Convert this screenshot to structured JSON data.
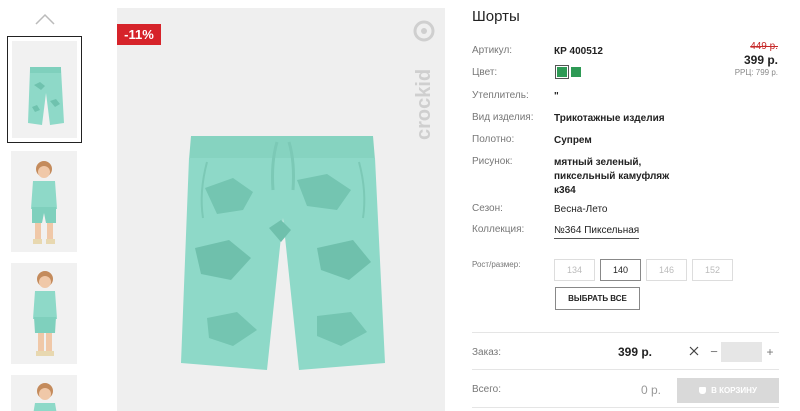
{
  "colors": {
    "accent_red": "#d6232a",
    "mint": "#8ed9c8",
    "swatch_green": "#2e9a55",
    "muted": "#777777"
  },
  "product": {
    "discount_badge": "-11%",
    "brand_logo_text": "crockid",
    "title": "Шорты",
    "old_price": "449 р.",
    "price": "399 р.",
    "rrp": "РРЦ: 799 р."
  },
  "attributes": [
    {
      "label": "Артикул:",
      "value": "КР 400512"
    },
    {
      "label": "Цвет:",
      "value": ""
    },
    {
      "label": "Утеплитель:",
      "value": "\""
    },
    {
      "label": "Вид изделия:",
      "value": "Трикотажные изделия"
    },
    {
      "label": "Полотно:",
      "value": "Супрем"
    },
    {
      "label": "Рисунок:",
      "value_lines": [
        "мятный зеленый,",
        "пиксельный камуфляж",
        "к364"
      ]
    },
    {
      "label": "Сезон:",
      "value": "Весна-Лето"
    },
    {
      "label": "Коллекция:",
      "value": "№364 Пиксельная"
    }
  ],
  "sizes": {
    "label": "Рост/размер:",
    "options": [
      "134",
      "140",
      "146",
      "152"
    ],
    "selected": "140",
    "select_all_label": "ВЫБРАТЬ ВСЕ"
  },
  "order": {
    "label": "Заказ:",
    "price": "399 р.",
    "quantity": ""
  },
  "total": {
    "label": "Всего:",
    "value": "0 р.",
    "cart_button_label": "В КОРЗИНУ"
  }
}
